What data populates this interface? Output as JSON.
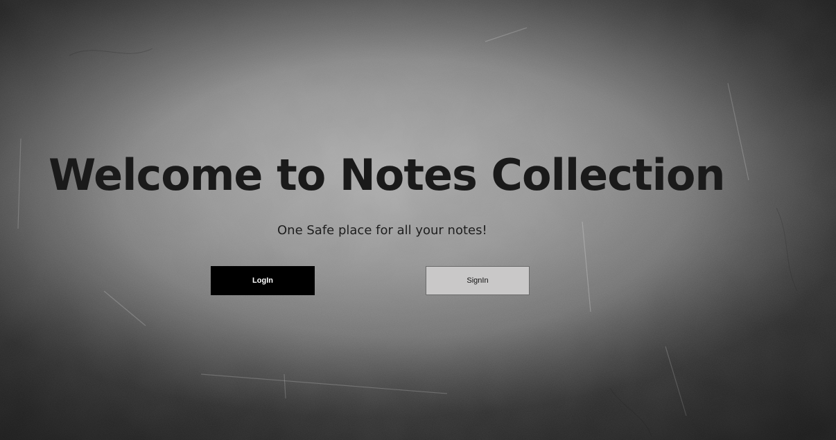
{
  "hero": {
    "title": "Welcome to Notes Collection",
    "subtitle": "One Safe place for all your notes!"
  },
  "actions": {
    "login_label": "LogIn",
    "signin_label": "SignIn"
  },
  "colors": {
    "login_bg": "#000000",
    "signin_bg": "#c9c8c8",
    "title_text": "#1a1a1a"
  }
}
